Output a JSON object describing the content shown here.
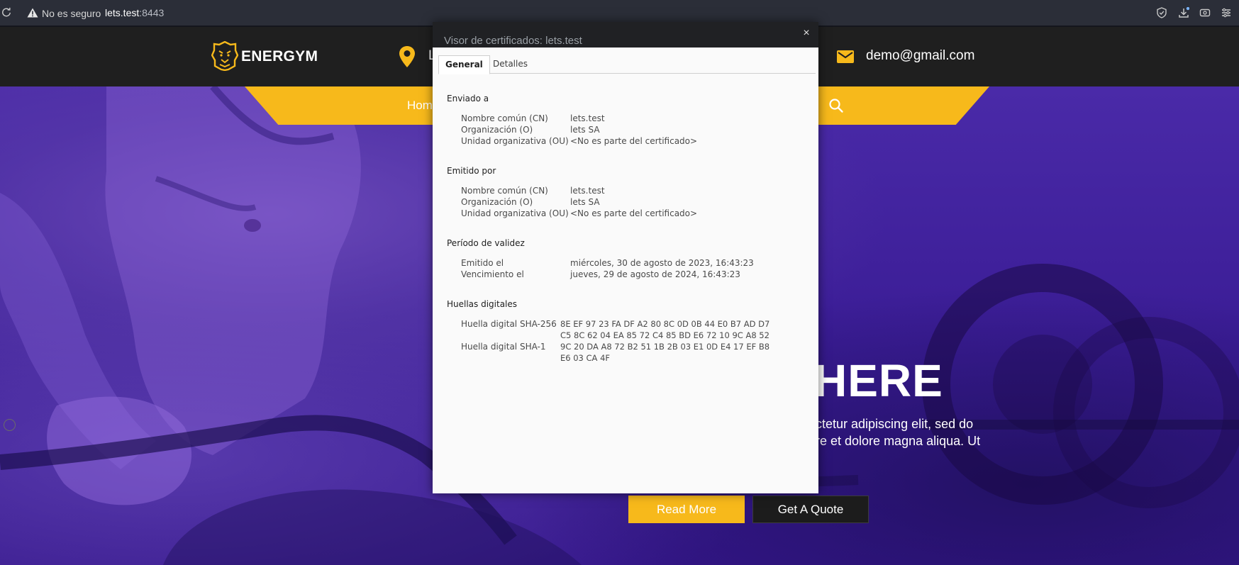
{
  "browser": {
    "not_secure": "No es seguro",
    "url_host": "lets.test",
    "url_port": ":8443"
  },
  "site": {
    "logo": "ENERGYM",
    "location_partial": "L",
    "email": "demo@gmail.com",
    "nav_home": "Hom",
    "hero_title_partial": "HERE",
    "hero_line1": "ectetur adipiscing elit, sed do",
    "hero_line2": "ore et dolore magna aliqua. Ut",
    "read_more": "Read More",
    "get_quote": "Get A Quote",
    "accent_color": "#f7b91b"
  },
  "dialog": {
    "title": "Visor de certificados: lets.test",
    "close": "×",
    "tabs": [
      "General",
      "Detalles"
    ],
    "issued_to": {
      "heading": "Enviado a",
      "rows": [
        {
          "label": "Nombre común (CN)",
          "value": "lets.test"
        },
        {
          "label": "Organización (O)",
          "value": "lets SA"
        },
        {
          "label": "Unidad organizativa (OU)",
          "value": "<No es parte del certificado>"
        }
      ]
    },
    "issued_by": {
      "heading": "Emitido por",
      "rows": [
        {
          "label": "Nombre común (CN)",
          "value": "lets.test"
        },
        {
          "label": "Organización (O)",
          "value": "lets SA"
        },
        {
          "label": "Unidad organizativa (OU)",
          "value": "<No es parte del certificado>"
        }
      ]
    },
    "validity": {
      "heading": "Período de validez",
      "rows": [
        {
          "label": "Emitido el",
          "value": "miércoles, 30 de agosto de 2023, 16:43:23"
        },
        {
          "label": "Vencimiento el",
          "value": "jueves, 29 de agosto de 2024, 16:43:23"
        }
      ]
    },
    "fingerprints": {
      "heading": "Huellas digitales",
      "sha256_label": "Huella digital SHA-256",
      "sha256_line1": "8E EF 97 23 FA DF A2 80 8C 0D 0B 44 E0 B7 AD D7",
      "sha256_line2": "C5 8C 62 04 EA 85 72 C4 85 BD E6 72 10 9C A8 52",
      "sha1_label": "Huella digital SHA-1",
      "sha1_line1": "9C 20 DA A8 72 B2 51 1B 2B 03 E1 0D E4 17 EF B8",
      "sha1_line2": "E6 03 CA 4F"
    }
  }
}
